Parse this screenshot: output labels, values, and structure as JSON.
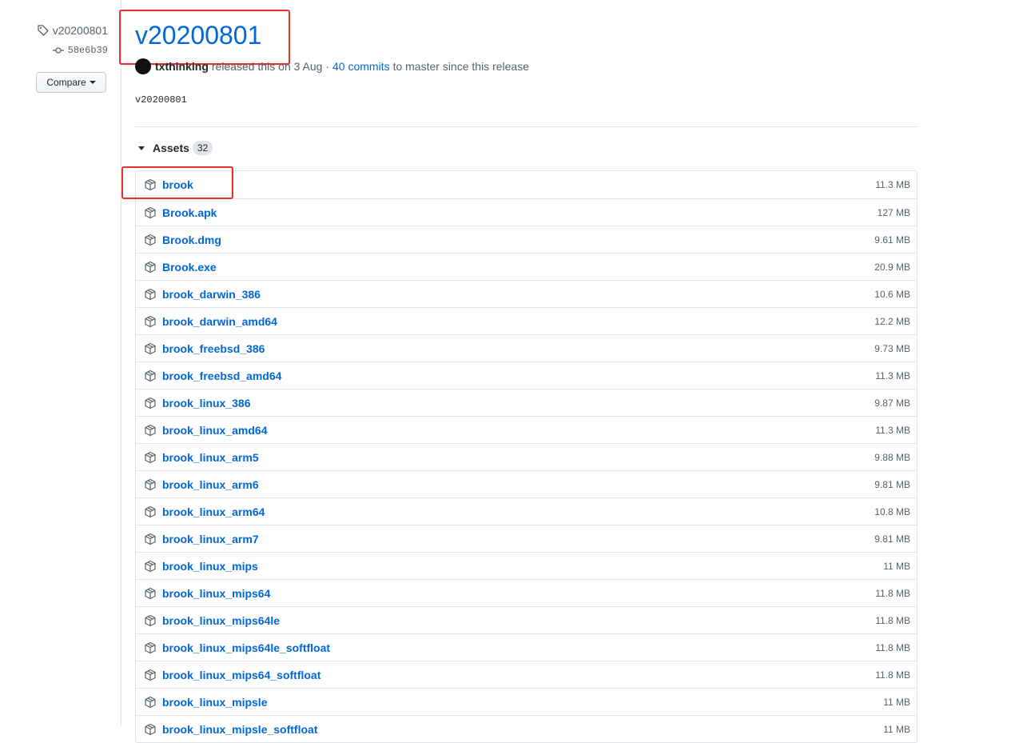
{
  "sidebar": {
    "tag": "v20200801",
    "commit": "58e6b39",
    "compare_label": "Compare"
  },
  "release": {
    "title": "v20200801",
    "author": "txthinking",
    "released_text": "released this on 3 Aug ·",
    "commits_link": "40 commits",
    "commits_suffix": "to master since this release",
    "body": "v20200801"
  },
  "assets": {
    "label": "Assets",
    "count": "32",
    "items": [
      {
        "name": "brook",
        "size": "11.3 MB"
      },
      {
        "name": "Brook.apk",
        "size": "127 MB"
      },
      {
        "name": "Brook.dmg",
        "size": "9.61 MB"
      },
      {
        "name": "Brook.exe",
        "size": "20.9 MB"
      },
      {
        "name": "brook_darwin_386",
        "size": "10.6 MB"
      },
      {
        "name": "brook_darwin_amd64",
        "size": "12.2 MB"
      },
      {
        "name": "brook_freebsd_386",
        "size": "9.73 MB"
      },
      {
        "name": "brook_freebsd_amd64",
        "size": "11.3 MB"
      },
      {
        "name": "brook_linux_386",
        "size": "9.87 MB"
      },
      {
        "name": "brook_linux_amd64",
        "size": "11.3 MB"
      },
      {
        "name": "brook_linux_arm5",
        "size": "9.88 MB"
      },
      {
        "name": "brook_linux_arm6",
        "size": "9.81 MB"
      },
      {
        "name": "brook_linux_arm64",
        "size": "10.8 MB"
      },
      {
        "name": "brook_linux_arm7",
        "size": "9.81 MB"
      },
      {
        "name": "brook_linux_mips",
        "size": "11 MB"
      },
      {
        "name": "brook_linux_mips64",
        "size": "11.8 MB"
      },
      {
        "name": "brook_linux_mips64le",
        "size": "11.8 MB"
      },
      {
        "name": "brook_linux_mips64le_softfloat",
        "size": "11.8 MB"
      },
      {
        "name": "brook_linux_mips64_softfloat",
        "size": "11.8 MB"
      },
      {
        "name": "brook_linux_mipsle",
        "size": "11 MB"
      },
      {
        "name": "brook_linux_mipsle_softfloat",
        "size": "11 MB"
      }
    ]
  },
  "colors": {
    "link": "#0366d6",
    "highlight": "#e5302b"
  }
}
